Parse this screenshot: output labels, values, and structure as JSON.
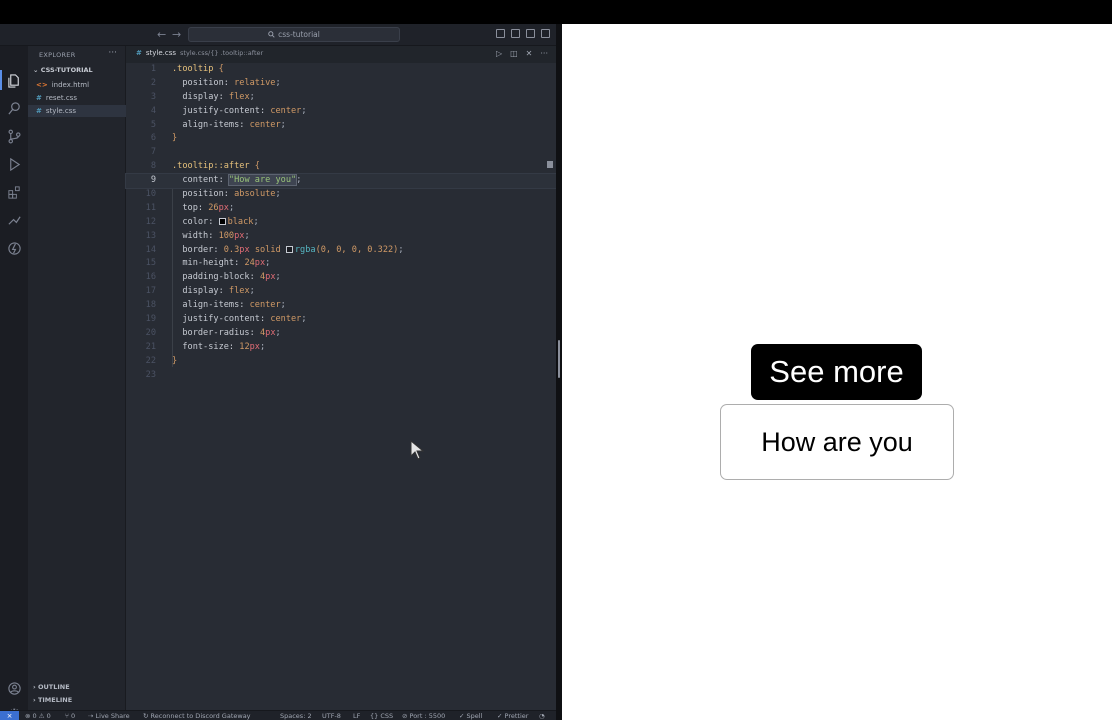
{
  "window": {
    "search_text": "css-tutorial",
    "nav_back": "←",
    "nav_forward": "→"
  },
  "sidebar": {
    "header": "EXPLORER",
    "more": "···",
    "folder": "CSS-TUTORIAL",
    "files": [
      {
        "icon": "<>",
        "name": "index.html"
      },
      {
        "icon": "#",
        "name": "reset.css"
      },
      {
        "icon": "#",
        "name": "style.css"
      }
    ],
    "active_file": "style.css",
    "outline": "OUTLINE",
    "timeline": "TIMELINE"
  },
  "editor": {
    "tab_icon": "#",
    "tab_name": "style.css",
    "breadcrumb": "style.css/{} .tooltip::after",
    "current_line": 9,
    "lines": [
      "1",
      "2",
      "3",
      "4",
      "5",
      "6",
      "7",
      "8",
      "9",
      "10",
      "11",
      "12",
      "13",
      "14",
      "15",
      "16",
      "17",
      "18",
      "19",
      "20",
      "21",
      "22",
      "23"
    ],
    "code": {
      "l1_sel": ".tooltip",
      "l1_brace": " {",
      "l2_prop": "  position: ",
      "l2_val": "relative",
      "l3_prop": "  display: ",
      "l3_val": "flex",
      "l4_prop": "  justify-content: ",
      "l4_val": "center",
      "l5_prop": "  align-items: ",
      "l5_val": "center",
      "l6": "}",
      "l8_sel": ".tooltip::after",
      "l8_brace": " {",
      "l9_prop": "  content: ",
      "l9_str": "\"How are you\"",
      "l10_prop": "  position: ",
      "l10_val": "absolute",
      "l11_prop": "  top: ",
      "l11_num": "26",
      "l11_unit": "px",
      "l12_prop": "  color: ",
      "l12_val": "black",
      "l13_prop": "  width: ",
      "l13_num": "100",
      "l13_unit": "px",
      "l14_prop": "  border: ",
      "l14_num": "0.3",
      "l14_unit": "px",
      "l14_mid": " solid ",
      "l14_func": "rgba",
      "l14_args": "(0, 0, 0, 0.322)",
      "l15_prop": "  min-height: ",
      "l15_num": "24",
      "l15_unit": "px",
      "l16_prop": "  padding-block: ",
      "l16_num": "4",
      "l16_unit": "px",
      "l17_prop": "  display: ",
      "l17_val": "flex",
      "l18_prop": "  align-items: ",
      "l18_val": "center",
      "l19_prop": "  justify-content: ",
      "l19_val": "center",
      "l20_prop": "  border-radius: ",
      "l20_num": "4",
      "l20_unit": "px",
      "l21_prop": "  font-size: ",
      "l21_num": "12",
      "l21_unit": "px",
      "l22": "}"
    }
  },
  "statusbar": {
    "remote": "⨯",
    "problems": "⊗ 0 ⚠ 0",
    "ports": "⑂ 0",
    "live_share": "Live Share",
    "discord": "Reconnect to Discord Gateway",
    "spaces": "Spaces: 2",
    "encoding": "UTF-8",
    "eol": "LF",
    "language": "{} CSS",
    "port": "⊘ Port : 5500",
    "spell": "✓ Spell",
    "prettier": "✓ Prettier"
  },
  "preview": {
    "button_label": "See more",
    "tooltip_text": "How are you"
  }
}
